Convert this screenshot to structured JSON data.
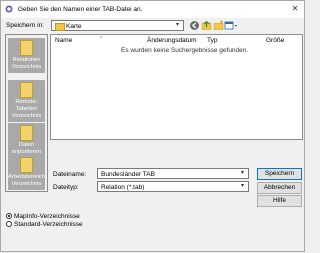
{
  "window": {
    "title": "Geben Sie den Namen einer TAB-Datei an."
  },
  "save_in": {
    "label": "Speichern in:",
    "value": "Karte"
  },
  "toolbar": {
    "icons": [
      "back-icon",
      "up-folder-icon",
      "new-folder-icon",
      "view-menu-icon"
    ]
  },
  "places": [
    {
      "label": "Relationen Verzeichnis"
    },
    {
      "label": "Remote-Tabellen Verzeichnis"
    },
    {
      "label": "Daten importieren Verzeichnis"
    },
    {
      "label": "Arbeitsbereich Verzeichnis"
    }
  ],
  "file_list": {
    "columns": [
      "Name",
      "Änderungsdatum",
      "Typ",
      "Größe"
    ],
    "empty_message": "Es wurden keine Suchergebnisse gefunden."
  },
  "filename": {
    "label": "Dateiname:",
    "value": "Bundesländer TAB"
  },
  "filetype": {
    "label": "Dateityp:",
    "value": "Relation (*.tab)"
  },
  "buttons": {
    "save": "Speichern",
    "cancel": "Abbrechen",
    "help": "Hilfe"
  },
  "radios": [
    {
      "label": "MapInfo-Verzeichnisse",
      "checked": true
    },
    {
      "label": "Standard-Verzeichnisse",
      "checked": false
    }
  ],
  "colors": {
    "accent": "#0078d7",
    "folder": "#f3c54a",
    "places_tile": "#a9a9a9"
  }
}
